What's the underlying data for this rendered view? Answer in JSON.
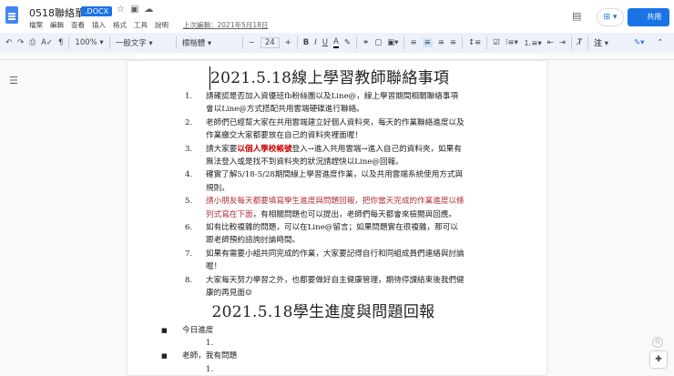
{
  "header": {
    "title": "0518聯絡單",
    "badge": ".DOCX",
    "menu": [
      "檔案",
      "編輯",
      "查看",
      "插入",
      "格式",
      "工具",
      "說明"
    ],
    "last_edit": "上次編輯：2021年5月18日",
    "share_label": "共用"
  },
  "toolbar": {
    "zoom": "100%",
    "style": "一般文字",
    "font": "標楷體",
    "size": "24",
    "mode_label": "注"
  },
  "doc": {
    "title1": "2021.5.18線上學習教師聯絡事項",
    "items": [
      {
        "n": "1.",
        "text": "請確認是否加入資優班fb粉絲團以及Line@，線上學習期間相關聯絡事項會以Line@方式搭配共用雲端硬碟進行聯絡。"
      },
      {
        "n": "2.",
        "text": "老師們已經幫大家在共用雲端建立好個人資料夾，每天的作業聯絡進度以及作業繳交大家都要放在自己的資料夾裡面喔！"
      },
      {
        "n": "3.",
        "pre": "請大家要",
        "red": "以個人學校帳號",
        "text": "登入→進入共用雲端→進入自己的資料夾，如果有無法登入或是找不到資料夾的狀況請趕快以Line@回報。"
      },
      {
        "n": "4.",
        "text": "確實了解5/18-5/28期間線上學習進度作業，以及共用雲端系統使用方式與規則。"
      },
      {
        "n": "5.",
        "dred": "請小朋友每天都要填寫學生進度與問題回報，把你當天完成的作業進度以條列式寫在下面",
        "text": "，有相關問題也可以提出，老師們每天都會來檢閱與回應。"
      },
      {
        "n": "6.",
        "text": "如有比較複雜的問題，可以在Line@留言；如果問題實在很複雜，那可以跟老師預約諮詢討論時間。"
      },
      {
        "n": "7.",
        "text": "如果有需要小組共同完成的作業，大家要記得自行和同組成員們連絡與討論喔！"
      },
      {
        "n": "8.",
        "text": "大家每天努力學習之外，也都要做好自主健康管理，期待停課結束後我們健康的再見面☺"
      }
    ],
    "title2": "2021.5.18學生進度與問題回報",
    "bullets": [
      {
        "label": "今日進度",
        "sub": "1."
      },
      {
        "label": "老師，我有問題",
        "sub": "1."
      }
    ]
  }
}
